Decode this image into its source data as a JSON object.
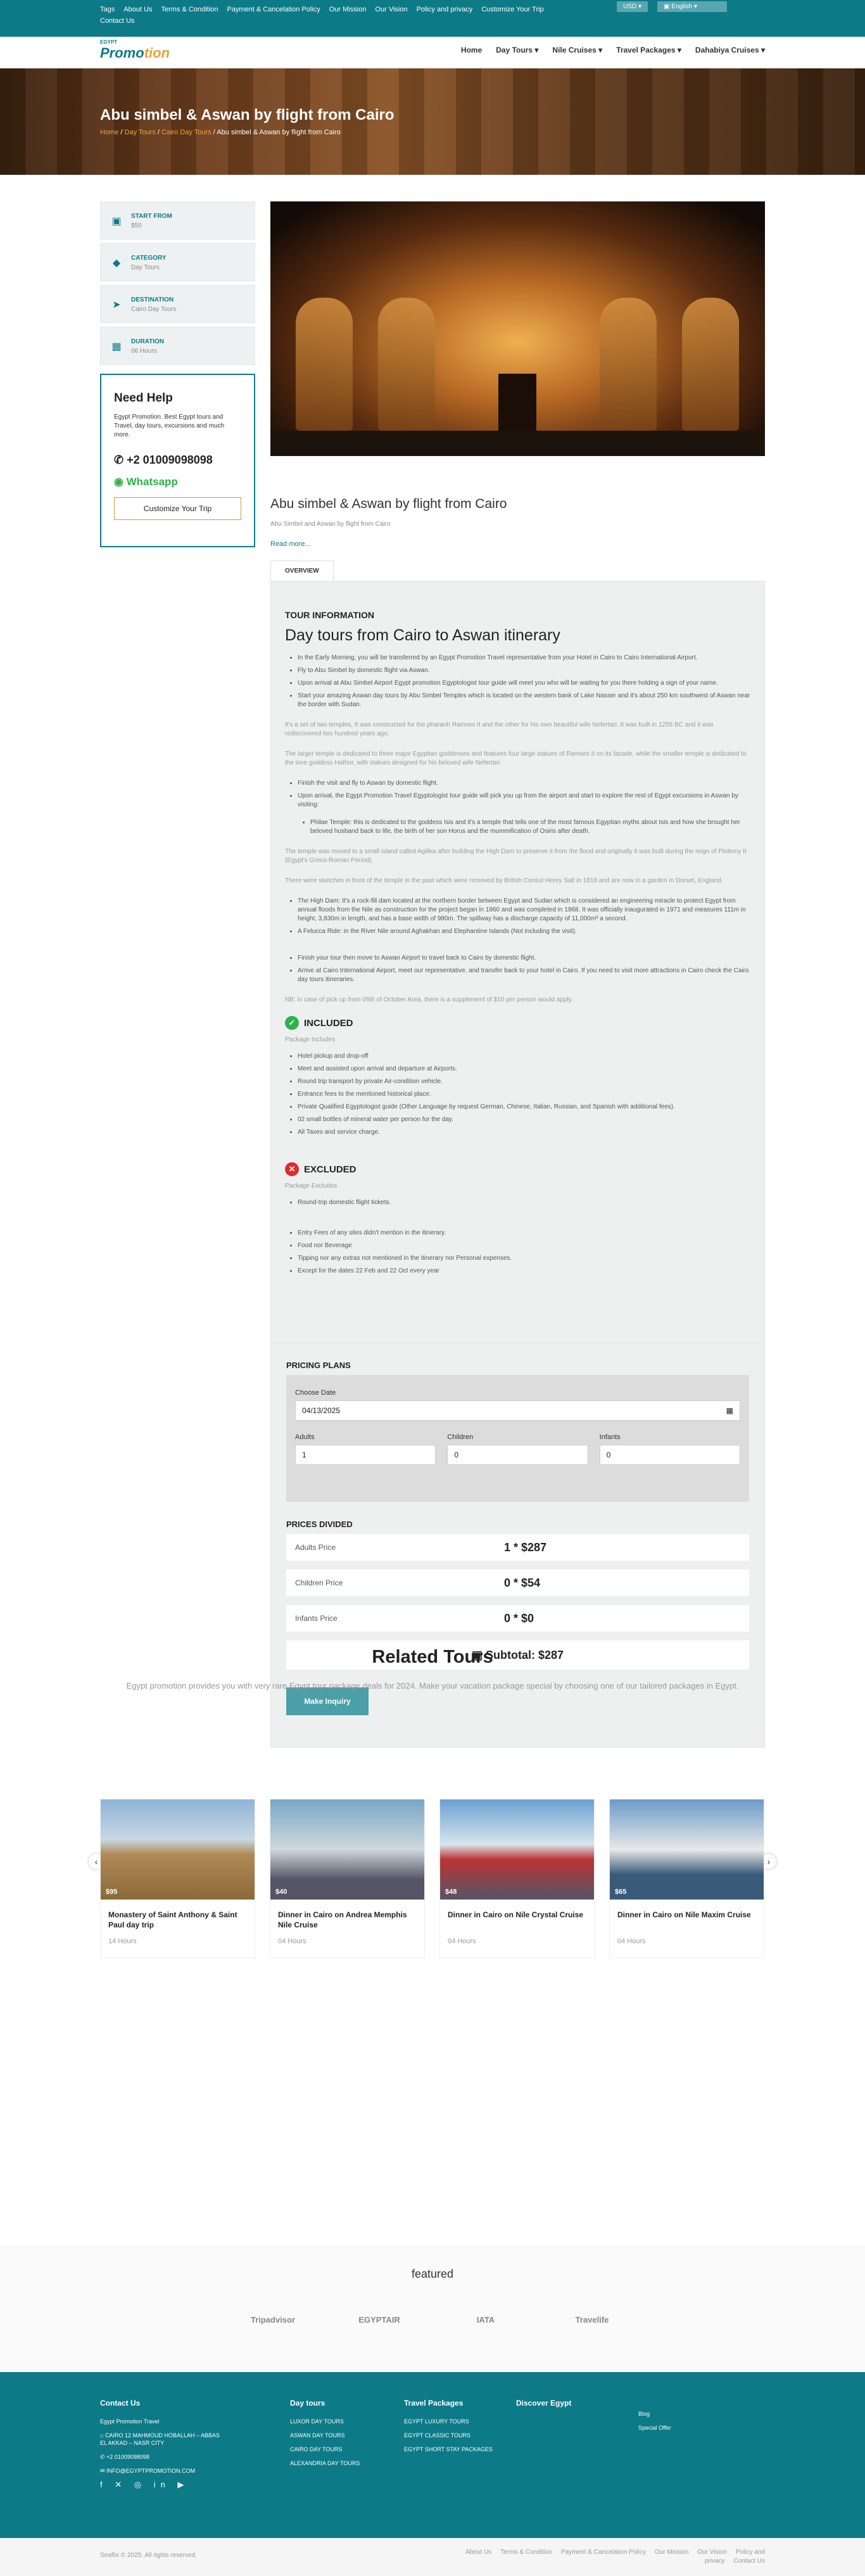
{
  "topbar": {
    "links": [
      "Tags",
      "About Us",
      "Terms & Condition",
      "Payment & Cancelation Policy",
      "Our Mission",
      "Our Vision",
      "Policy and privacy",
      "Customize Your Trip",
      "Contact Us"
    ],
    "currency": "USD",
    "language": "English"
  },
  "nav": {
    "logo_top": "EGYPT",
    "logo_main": "Promo",
    "logo_accent": "tion",
    "items": [
      "Home",
      "Day Tours",
      "Nile Cruises",
      "Travel Packages",
      "Dahabiya Cruises"
    ]
  },
  "hero": {
    "title": "Abu simbel & Aswan by flight from Cairo",
    "bc_home": "Home",
    "bc_day": "Day Tours",
    "bc_cairo": "Cairo Day Tours",
    "bc_cur": "Abu simbel & Aswan by flight from Cairo"
  },
  "sidebar": {
    "items": [
      {
        "t": "START FROM",
        "v": "$50"
      },
      {
        "t": "CATEGORY",
        "v": "Day Tours"
      },
      {
        "t": "DESTINATION",
        "v": "Cairo Day Tours"
      },
      {
        "t": "DURATION",
        "v": "06 Hours"
      }
    ],
    "help_title": "Need Help",
    "help_text": "Egypt Promotion. Best Egypt tours and Travel, day tours, excursions and much more.",
    "phone": "+2 01009098098",
    "whatsapp": "Whatsapp",
    "customize": "Customize Your Trip"
  },
  "tour": {
    "title": "Abu simbel & Aswan by flight from Cairo",
    "subtitle": "Abu Simbel and Aswan by flight from Cairo",
    "read_more": "Read more...",
    "tab": "OVERVIEW"
  },
  "overview": {
    "info_title": "TOUR INFORMATION",
    "itin_title": "Day tours from Cairo to Aswan itinerary",
    "l1": [
      "In the Early Morning, you will be transferred by an Egypt Promotion Travel representative from your Hotel in Cairo to Cairo International Airport.",
      "Fly to Abu Simbel by domestic flight via Aswan.",
      "Upon arrival at Abu Simbel Airport Egypt promotion Egyptologist tour guide will meet you who will be waiting for you there holding a sign of your name.",
      "Start your amazing Aswan day tours by Abu Simbel Temples which is located on the western bank of Lake Nasser and it's about 250 km southwest of Aswan near the border with Sudan."
    ],
    "p1": "It's a set of two temples, It was constructed for the pharaoh Ramses II and the other for his own beautiful wife Nefertari. It was built in 1255 BC and it was rediscovered two hundred years ago.",
    "p2": "The larger temple is dedicated to three major Egyptian goddesses and features four large statues of Ramses II on its facade, while the smaller temple is dedicated to the love goddess Hathor, with statues designed for his beloved wife Nefertari.",
    "l2": [
      "Finish the visit and fly to Aswan by domestic flight.",
      "Upon arrival, the Egypt Promotion Travel Egyptologist tour guide will pick you up from the airport and start to explore the rest of Egypt excursions in Aswan by visiting:"
    ],
    "l2b": "Philae Temple: this is dedicated to the goddess Isis and it's a temple that tells one of the most famous Egyptian myths about Isis and how she brought her beloved husband back to life, the birth of her son Horus and the mummification of Osiris after death.",
    "p3": "The temple was moved to a small island called Agilika after building the High Dam to preserve it from the flood and originally it was built during the reign of Ptolemy II (Egypt's Greco-Roman Period).",
    "p4": "There were sketches in front of the temple in the past which were removed by British Consul Henry Salt in 1818 and are now in a garden in Dorset, England.",
    "l3": [
      "The High Dam: It's a rock-fill dam located at the northern border between Egypt and Sudan which is considered an engineering miracle to protect Egypt from annual floods from the Nile as construction for the project began in 1960 and was completed in 1968. It was officially inaugurated in 1971 and measures 111m in height, 3,830m in length, and has a base width of 980m. The spillway has a discharge capacity of 11,000m³ a second.",
      "A Felucca Ride: in the River Nile around Aghakhan and Elephantine Islands (Not including the visit)."
    ],
    "l4": [
      "Finish your tour then move to Aswan Airport to travel back to Cairo by domestic flight.",
      "Arrive at Cairo International Airport, meet our representative, and transfer back to your hotel in Cairo. If you need to visit more attractions in Cairo check the Cairo day tours itineraries."
    ],
    "note": "NB: in case of pick up from 06th of October Area, there is a supplement of $10 per person would apply.",
    "inc_title": "INCLUDED",
    "inc_sub": "Package Includes",
    "inc": [
      "Hotel pickup and drop-off",
      "Meet and assisted upon arrival and departure at Airports.",
      "Round trip transport by private Air-condition vehicle.",
      "Entrance fees to the mentioned historical place.",
      "Private Qualified Egyptologist guide (Other Language by request German, Chinese, Italian, Russian, and Spanish with additional fees).",
      "02 small bottles of mineral water per person for the day.",
      "All Taxes and service charge."
    ],
    "exc_title": "EXCLUDED",
    "exc_sub": "Package Excludes",
    "exc1": [
      "Round-trip domestic flight tickets."
    ],
    "exc2": [
      "Entry Fees of any sites didn't mention in the itinerary.",
      "Food nor Beverage",
      "Tipping nor any extras not mentioned in the itinerary nor Personal expenses.",
      "Except for the dates 22 Feb and 22 Oct every year"
    ]
  },
  "pricing": {
    "title": "PRICING PLANS",
    "choose_date": "Choose Date",
    "date": "04/13/2025",
    "adults_l": "Adults",
    "adults": "1",
    "children_l": "Children",
    "children": "0",
    "infants_l": "Infants",
    "infants": "0",
    "divided": "PRICES DIVIDED",
    "rows": [
      {
        "l": "Adults Price",
        "v": "1 * $287"
      },
      {
        "l": "Children Price",
        "v": "0 * $54"
      },
      {
        "l": "Infants Price",
        "v": "0 * $0"
      }
    ],
    "subtotal": "Subtotal: $287",
    "inquiry": "Make Inquiry"
  },
  "related": {
    "title": "Related Tours",
    "text": "Egypt promotion provides you with very rare Egypt tour package deals for 2024. Make your vacation package special by choosing one of our tailored packages in Egypt.",
    "cards": [
      {
        "n": "Monastery of Saint Anthony & Saint Paul day trip",
        "d": "14 Hours",
        "p": "$95"
      },
      {
        "n": "Dinner in Cairo on Andrea Memphis Nile Cruise",
        "d": "04 Hours",
        "p": "$40"
      },
      {
        "n": "Dinner in Cairo on Nile Crystal Cruise",
        "d": "04 Hours",
        "p": "$48"
      },
      {
        "n": "Dinner in Cairo on Nile Maxim Cruise",
        "d": "04 Hours",
        "p": "$65"
      }
    ]
  },
  "featured": {
    "title": "featured",
    "logos": [
      "Tripadvisor",
      "EGYPTAIR",
      "IATA",
      "Travelife"
    ]
  },
  "footer": {
    "contact": "Contact Us",
    "company": "Egypt Promotion Travel",
    "addr": "CAIRO 12 MAHMOUD HOBALLAH – ABBAS EL AKKAD – NASR CITY",
    "tel": "+2 01009098098",
    "email": "INFO@EGYPTPROMOTION.COM",
    "c2": "Day tours",
    "c2i": [
      "LUXOR DAY TOURS",
      "ASWAN DAY TOURS",
      "CAIRO DAY TOURS",
      "ALEXANDRIA DAY TOURS"
    ],
    "c3": "Travel Packages",
    "c3i": [
      "EGYPT LUXURY TOURS",
      "EGYPT CLASSIC TOURS",
      "EGYPT SHORT STAY PACKAGES"
    ],
    "c4": "Discover Egypt",
    "c5i": [
      "Blog",
      "Special Offer"
    ]
  },
  "copy": {
    "text": "Seaflix © 2025. All rights reserved.",
    "links": [
      "About Us",
      "Terms & Condition",
      "Payment & Cancelation Policy",
      "Our Mission",
      "Our Vision",
      "Policy and privacy",
      "Contact Us"
    ]
  }
}
